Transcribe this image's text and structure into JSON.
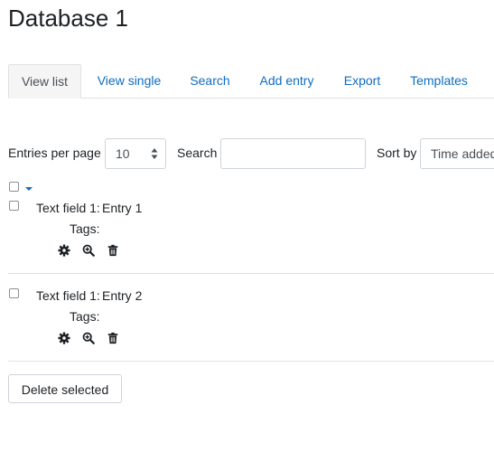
{
  "page_title": "Database 1",
  "tabs": [
    {
      "label": "View list",
      "active": true
    },
    {
      "label": "View single",
      "active": false
    },
    {
      "label": "Search",
      "active": false
    },
    {
      "label": "Add entry",
      "active": false
    },
    {
      "label": "Export",
      "active": false
    },
    {
      "label": "Templates",
      "active": false
    }
  ],
  "controls": {
    "entries_per_page_label": "Entries per page",
    "entries_per_page_value": "10",
    "search_label": "Search",
    "search_value": "",
    "sort_by_label": "Sort by",
    "sort_by_value": "Time added"
  },
  "entries": [
    {
      "field_label": "Text field 1:",
      "field_value": "Entry 1",
      "tags_label": "Tags:"
    },
    {
      "field_label": "Text field 1:",
      "field_value": "Entry 2",
      "tags_label": "Tags:"
    }
  ],
  "delete_button_label": "Delete selected",
  "icons": {
    "settings": "gear-icon",
    "view": "zoom-in-icon",
    "delete": "trash-icon"
  },
  "colors": {
    "link": "#0f6cbf",
    "text": "#1d2125",
    "border": "#dee2e6"
  }
}
